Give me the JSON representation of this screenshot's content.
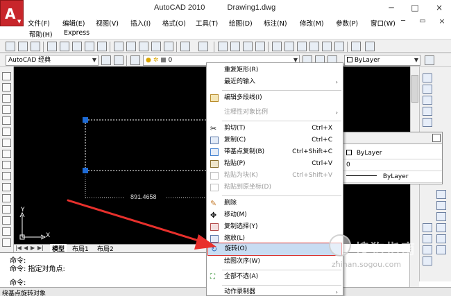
{
  "window": {
    "app_title": "AutoCAD 2010",
    "document_title": "Drawing1.dwg",
    "minimize": "─",
    "restore": "□",
    "close": "×",
    "doc_minimize": "─",
    "doc_restore": "▭",
    "doc_close": "×"
  },
  "menubar": {
    "items": [
      "文件(F)",
      "编辑(E)",
      "视图(V)",
      "插入(I)",
      "格式(O)",
      "工具(T)",
      "绘图(D)",
      "标注(N)",
      "修改(M)",
      "参数(P)",
      "窗口(W)"
    ],
    "row2": [
      "帮助(H)",
      "Express"
    ]
  },
  "toolbar2": {
    "workspace": "AutoCAD 经典",
    "layer_value": "0",
    "bylayer_value": "ByLayer"
  },
  "props_panel": {
    "rows": [
      "ByLayer",
      "0",
      "ByLayer"
    ]
  },
  "canvas": {
    "dimension_text": "891.4658",
    "axis_x": "X",
    "axis_y": "Y",
    "crosshair_symbol": "+"
  },
  "tabs": {
    "model": "模型",
    "layout1": "布局1",
    "layout2": "布局2"
  },
  "command": {
    "lines": [
      "命令:",
      "命令: 指定对角点:",
      "命令:"
    ]
  },
  "status": {
    "text": "绕基点旋转对象"
  },
  "context_menu": {
    "items": [
      {
        "label": "重复矩形(R)",
        "shortcut": "",
        "submenu": false,
        "disabled": false
      },
      {
        "label": "最近的输入",
        "shortcut": "",
        "submenu": true,
        "disabled": false
      },
      {
        "label": "编辑多段线(I)",
        "shortcut": "",
        "submenu": false,
        "disabled": false
      },
      {
        "label": "注释性对象比例",
        "shortcut": "",
        "submenu": true,
        "disabled": true
      },
      {
        "label": "剪切(T)",
        "shortcut": "Ctrl+X",
        "submenu": false,
        "disabled": false
      },
      {
        "label": "复制(C)",
        "shortcut": "Ctrl+C",
        "submenu": false,
        "disabled": false
      },
      {
        "label": "带基点复制(B)",
        "shortcut": "Ctrl+Shift+C",
        "submenu": false,
        "disabled": false
      },
      {
        "label": "粘贴(P)",
        "shortcut": "Ctrl+V",
        "submenu": false,
        "disabled": false
      },
      {
        "label": "粘贴为块(K)",
        "shortcut": "Ctrl+Shift+V",
        "submenu": false,
        "disabled": true
      },
      {
        "label": "粘贴到原坐标(D)",
        "shortcut": "",
        "submenu": false,
        "disabled": true
      },
      {
        "label": "删除",
        "shortcut": "",
        "submenu": false,
        "disabled": false
      },
      {
        "label": "移动(M)",
        "shortcut": "",
        "submenu": false,
        "disabled": false
      },
      {
        "label": "复制选择(Y)",
        "shortcut": "",
        "submenu": false,
        "disabled": false
      },
      {
        "label": "缩放(L)",
        "shortcut": "",
        "submenu": false,
        "disabled": false
      },
      {
        "label": "旋转(O)",
        "shortcut": "",
        "submenu": false,
        "disabled": false
      },
      {
        "label": "绘图次序(W)",
        "shortcut": "",
        "submenu": true,
        "disabled": false
      },
      {
        "label": "全部不选(A)",
        "shortcut": "",
        "submenu": false,
        "disabled": false
      },
      {
        "label": "动作录制器",
        "shortcut": "",
        "submenu": true,
        "disabled": false
      }
    ],
    "highlighted": "旋转(O)"
  },
  "watermark": {
    "text": "搜狗指南",
    "url": "zhinan.sogou.com"
  },
  "colors": {
    "canvas_bg": "#000000",
    "grip_blue": "#1e6bd6",
    "highlight_bg": "#c8dcf2",
    "annotation_red": "#e8302c",
    "logo_red": "#c8262b"
  }
}
